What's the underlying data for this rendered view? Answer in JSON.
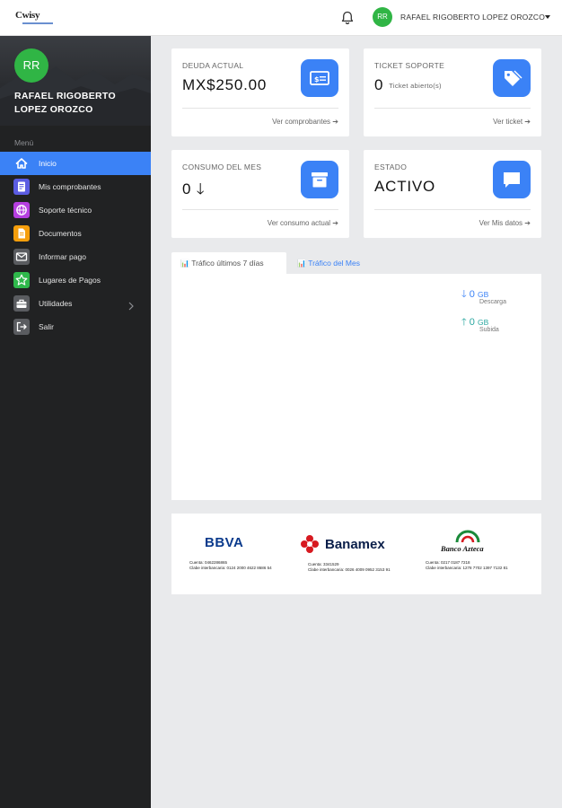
{
  "header": {
    "logo_text": "Cwisy",
    "user_initials": "RR",
    "user_name": "RAFAEL RIGOBERTO LOPEZ OROZCO"
  },
  "sidebar": {
    "avatar_initials": "RR",
    "name_line1": "RAFAEL RIGOBERTO",
    "name_line2": "LOPEZ OROZCO",
    "menu_title": "Menú",
    "items": [
      {
        "label": "Inicio",
        "icon": "home-icon",
        "color": "#3b82f6"
      },
      {
        "label": "Mis comprobantes",
        "icon": "receipt-icon",
        "color": "#5b5ce2"
      },
      {
        "label": "Soporte técnico",
        "icon": "globe-icon",
        "color": "#b63fe0"
      },
      {
        "label": "Documentos",
        "icon": "document-icon",
        "color": "#f59e0b"
      },
      {
        "label": "Informar pago",
        "icon": "mail-icon",
        "color": "#5a5c60"
      },
      {
        "label": "Lugares de Pagos",
        "icon": "star-icon",
        "color": "#2fb84b"
      },
      {
        "label": "Utilidades",
        "icon": "toolbox-icon",
        "color": "#5a5c60"
      },
      {
        "label": "Salir",
        "icon": "logout-icon",
        "color": "#5a5c60"
      }
    ]
  },
  "cards": {
    "debt": {
      "label": "DEUDA ACTUAL",
      "value": "MX$250.00",
      "link": "Ver comprobantes"
    },
    "ticket": {
      "label": "TICKET SOPORTE",
      "value": "0",
      "suffix": "Ticket abierto(s)",
      "link": "Ver ticket"
    },
    "usage": {
      "label": "CONSUMO DEL MES",
      "value": "0",
      "link": "Ver consumo actual"
    },
    "status": {
      "label": "ESTADO",
      "value": "ACTIVO",
      "link": "Ver Mis datos"
    }
  },
  "traffic": {
    "tab_week": "Tráfico últimos 7 días",
    "tab_month": "Tráfico del Mes",
    "download_value": "0",
    "download_unit": "GB",
    "download_label": "Descarga",
    "upload_value": "0",
    "upload_unit": "GB",
    "upload_label": "Subida"
  },
  "banks": {
    "bbva": {
      "name": "BBVA",
      "line1": "Cuenta: 0462286865",
      "line2": "Clabe interbancaria: 0124 2000 4622 8686 54"
    },
    "banamex": {
      "name": "Banamex",
      "line1": "Cuenta: 3341529",
      "line2": "Clabe interbancaria: 0026 4009 0952 3153 91"
    },
    "azteca": {
      "name": "Banco Azteca",
      "line1": "Cuenta: 0217 0187 7218",
      "line2": "Clabe interbancaria: 1278 7702 1397 7132 81"
    }
  },
  "colors": {
    "accent": "#3b82f6",
    "success": "#30b545",
    "sidebar": "#212223"
  }
}
